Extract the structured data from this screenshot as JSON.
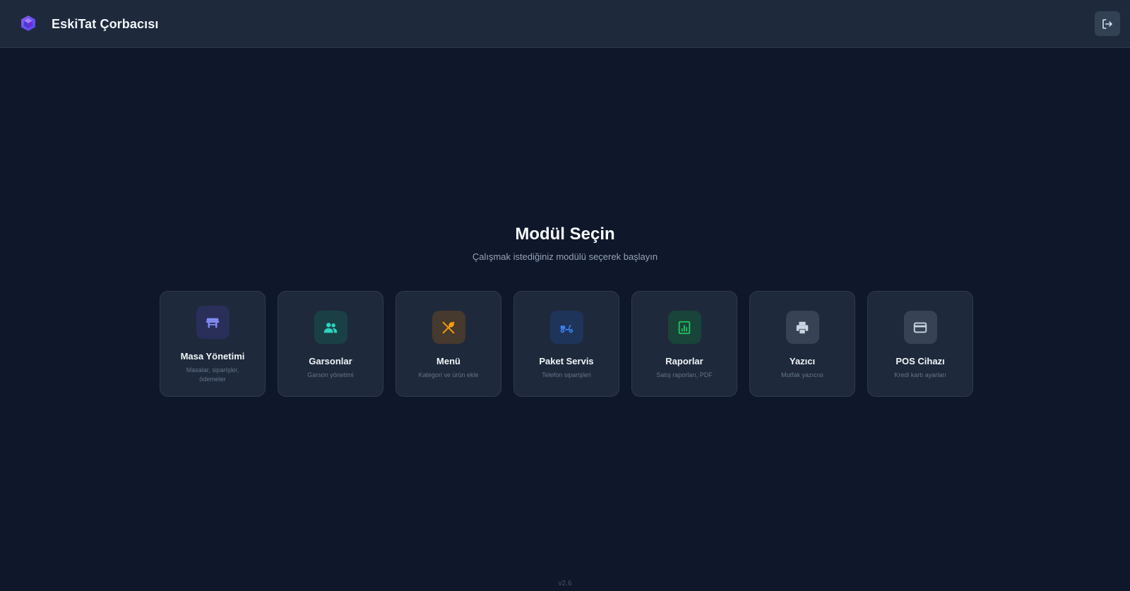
{
  "header": {
    "app_title": "EskiTat Çorbacısı",
    "logo_icon": "cube-logo-icon",
    "logout_icon": "logout-icon"
  },
  "main": {
    "heading": "Modül Seçin",
    "subheading": "Çalışmak istediğiniz modülü seçerek başlayın"
  },
  "modules": [
    {
      "title": "Masa Yönetimi",
      "desc": "Masalar, siparişler, ödemeler",
      "icon": "table-icon",
      "color": "#818cf8",
      "bg": "#2a2f5a"
    },
    {
      "title": "Garsonlar",
      "desc": "Garson yönetimi",
      "icon": "users-icon",
      "color": "#2dd4bf",
      "bg": "#1a4045"
    },
    {
      "title": "Menü",
      "desc": "Kategori ve ürün ekle",
      "icon": "utensils-icon",
      "color": "#f59e0b",
      "bg": "#46392e"
    },
    {
      "title": "Paket Servis",
      "desc": "Telefon siparişleri",
      "icon": "scooter-icon",
      "color": "#3b82f6",
      "bg": "#1f3459"
    },
    {
      "title": "Raporlar",
      "desc": "Satış raporları, PDF",
      "icon": "report-chart-icon",
      "color": "#22c55e",
      "bg": "#18443a"
    },
    {
      "title": "Yazıcı",
      "desc": "Mutfak yazıcısı",
      "icon": "printer-icon",
      "color": "#cbd5e1",
      "bg": "#374254"
    },
    {
      "title": "POS Cihazı",
      "desc": "Kredi kartı ayarları",
      "icon": "credit-card-icon",
      "color": "#cbd5e1",
      "bg": "#374254"
    }
  ],
  "footer": {
    "version": "v2.6"
  }
}
